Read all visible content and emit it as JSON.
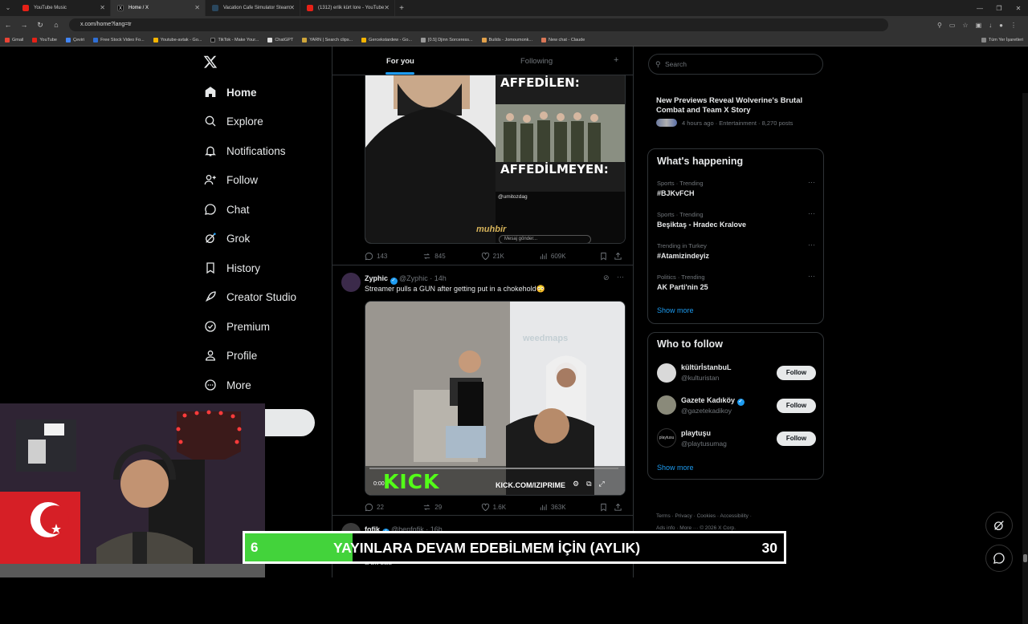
{
  "browser": {
    "tabs": [
      {
        "title": "YouTube Music",
        "favicon_color": "#e62117",
        "active": false
      },
      {
        "title": "Home / X",
        "favicon_color": "#000000",
        "active": true
      },
      {
        "title": "Vacation Cafe Simulator Steam",
        "favicon_color": "#2a475e",
        "active": false
      },
      {
        "title": "(1312) erlik kürt lore - YouTube",
        "favicon_color": "#e62117",
        "active": false
      }
    ],
    "new_tab": "+",
    "url": "x.com/home?lang=tr",
    "bookmarks": [
      "Gmail",
      "YouTube",
      "Çeviri",
      "Free Stock Video Fo...",
      "Youtube-avtak - Go...",
      "TikTok - Make Your...",
      "ChatGPT",
      "YARN | Search clips...",
      "Gercekstardew - Go...",
      "[0.5] Djinn Sorceress...",
      "Builds - Jomoumonk...",
      "New chat - Claude"
    ],
    "bookmarks_right": "Tüm Yer İşaretleri"
  },
  "x": {
    "nav": [
      {
        "label": "Home",
        "icon": "home-icon",
        "bold": true
      },
      {
        "label": "Explore",
        "icon": "search-icon"
      },
      {
        "label": "Notifications",
        "icon": "bell-icon"
      },
      {
        "label": "Follow",
        "icon": "person-add-icon"
      },
      {
        "label": "Chat",
        "icon": "chat-icon"
      },
      {
        "label": "Grok",
        "icon": "grok-icon"
      },
      {
        "label": "History",
        "icon": "bookmark-icon"
      },
      {
        "label": "Creator Studio",
        "icon": "rocket-icon"
      },
      {
        "label": "Premium",
        "icon": "verified-icon"
      },
      {
        "label": "Profile",
        "icon": "person-icon"
      },
      {
        "label": "More",
        "icon": "more-circle-icon"
      }
    ],
    "feed": {
      "tab_for_you": "For you",
      "tab_following": "Following",
      "media1": {
        "caption_top": "AFFEDİLEN:",
        "caption_bottom": "AFFEDİLMEYEN:",
        "handle_overlay": "@umitozdag",
        "watermark": "muhbir",
        "message_hint": "Mesaj gönder..."
      },
      "tweet1_stats": {
        "replies": "143",
        "reposts": "845",
        "likes": "21K",
        "views": "609K"
      },
      "tweet2": {
        "name": "Zyphic",
        "handle": "@Zyphic · 14h",
        "text": "Streamer pulls a GUN after getting put in a chokehold😳",
        "video_watermark": "weedmaps",
        "kick_logo": "KICK",
        "kick_url": "KICK.COM/IZIPRIME",
        "time": "0:00",
        "stats": {
          "replies": "22",
          "reposts": "29",
          "likes": "1.6K",
          "views": "363K"
        }
      },
      "tweet3": {
        "name": "fofik",
        "handle": "@benfofik · 16h",
        "text_partial": "a bit sad"
      }
    },
    "sidebar": {
      "search_placeholder": "Search",
      "news": {
        "title": "New Previews Reveal Wolverine's Brutal Combat and Team X Story",
        "meta": "4 hours ago · Entertainment · 8,270 posts"
      },
      "whats_happening_title": "What's happening",
      "trends": [
        {
          "meta": "Sports · Trending",
          "name": "#BJKvFCH"
        },
        {
          "meta": "Sports · Trending",
          "name": "Beşiktaş - Hradec Kralove"
        },
        {
          "meta": "Trending in Turkey",
          "name": "#Atamizindeyiz"
        },
        {
          "meta": "Politics · Trending",
          "name": "AK Parti'nin 25"
        }
      ],
      "show_more": "Show more",
      "who_to_follow_title": "Who to follow",
      "who_to_follow": [
        {
          "name": "kültürİstanbuL",
          "handle": "@kulturistan",
          "avatar_color": "#d9d9d9"
        },
        {
          "name": "Gazete Kadıköy",
          "handle": "@gazetekadikoy",
          "avatar_color": "#8a8a7a"
        },
        {
          "name": "playtuşu",
          "handle": "@playtusumag",
          "avatar_color": "#000000"
        }
      ],
      "follow_label": "Follow",
      "footer": [
        "Terms",
        "Privacy",
        "Cookies",
        "Accessibility",
        "Ads info",
        "More ···",
        "© 2026 X Corp."
      ]
    }
  },
  "overlay": {
    "goal_left": "6",
    "goal_text": "YAYINLARA DEVAM EDEBİLMEM İÇİN (AYLIK)",
    "goal_right": "30",
    "goal_progress": 0.2,
    "goal_color": "#43d33b"
  }
}
